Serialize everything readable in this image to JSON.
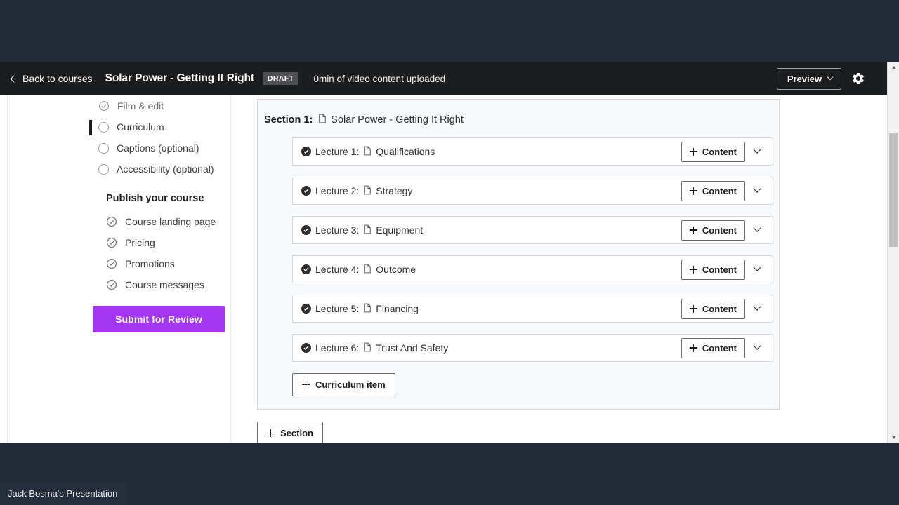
{
  "header": {
    "back_label": "Back to courses",
    "back_icon": "chevron-left-icon",
    "course_title": "Solar Power - Getting It Right",
    "draft_badge": "DRAFT",
    "video_status": "0min of video content uploaded",
    "preview_label": "Preview",
    "preview_icon": "chevron-down-icon",
    "settings_icon": "gear-icon"
  },
  "sidebar": {
    "plan_items": [
      {
        "label": "Film & edit",
        "state": "complete",
        "icon": "check-circle-icon",
        "active": false
      },
      {
        "label": "Curriculum",
        "state": "incomplete",
        "icon": "circle-icon",
        "active": true
      },
      {
        "label": "Captions (optional)",
        "state": "incomplete",
        "icon": "circle-icon",
        "active": false
      },
      {
        "label": "Accessibility (optional)",
        "state": "incomplete",
        "icon": "circle-icon",
        "active": false
      }
    ],
    "publish_heading": "Publish your course",
    "publish_items": [
      {
        "label": "Course landing page",
        "state": "complete",
        "icon": "check-circle-icon"
      },
      {
        "label": "Pricing",
        "state": "complete",
        "icon": "check-circle-icon"
      },
      {
        "label": "Promotions",
        "state": "complete",
        "icon": "check-circle-icon"
      },
      {
        "label": "Course messages",
        "state": "complete",
        "icon": "check-circle-icon"
      }
    ],
    "submit_label": "Submit for Review"
  },
  "main": {
    "section": {
      "number_label": "Section 1:",
      "title": "Solar Power - Getting It Right",
      "doc_icon": "document-icon"
    },
    "lectures": [
      {
        "number": "Lecture 1:",
        "title": "Qualifications",
        "status_icon": "check-circle-filled-icon",
        "doc_icon": "document-icon",
        "content_label": "Content",
        "expand_icon": "chevron-down-icon"
      },
      {
        "number": "Lecture 2:",
        "title": "Strategy",
        "status_icon": "check-circle-filled-icon",
        "doc_icon": "document-icon",
        "content_label": "Content",
        "expand_icon": "chevron-down-icon"
      },
      {
        "number": "Lecture 3:",
        "title": "Equipment",
        "status_icon": "check-circle-filled-icon",
        "doc_icon": "document-icon",
        "content_label": "Content",
        "expand_icon": "chevron-down-icon"
      },
      {
        "number": "Lecture 4:",
        "title": "Outcome",
        "status_icon": "check-circle-filled-icon",
        "doc_icon": "document-icon",
        "content_label": "Content",
        "expand_icon": "chevron-down-icon"
      },
      {
        "number": "Lecture 5:",
        "title": "Financing",
        "status_icon": "check-circle-filled-icon",
        "doc_icon": "document-icon",
        "content_label": "Content",
        "expand_icon": "chevron-down-icon"
      },
      {
        "number": "Lecture 6:",
        "title": "Trust And Safety",
        "status_icon": "check-circle-filled-icon",
        "doc_icon": "document-icon",
        "content_label": "Content",
        "expand_icon": "chevron-down-icon"
      }
    ],
    "curriculum_item_label": "Curriculum item",
    "add_section_label": "Section"
  },
  "scrollbar": {
    "up_icon": "scroll-up-arrow-icon",
    "down_icon": "scroll-down-arrow-icon"
  },
  "overlay": {
    "presentation_label": "Jack Bosma's Presentation"
  },
  "colors": {
    "accent_purple": "#a435f0",
    "header_dark": "#1c1d1f",
    "desktop_bg": "#222c38",
    "card_bg": "#f7f9fa",
    "border": "#d1d7dc"
  }
}
